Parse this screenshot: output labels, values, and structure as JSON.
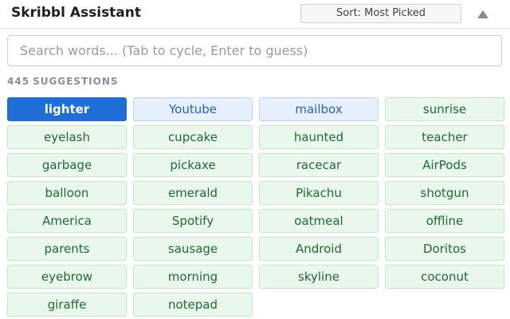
{
  "header": {
    "title": "Skribbl Assistant",
    "sort_label": "Sort: Most Picked",
    "collapse_icon": "triangle-up-icon"
  },
  "search": {
    "placeholder": "Search words... (Tab to cycle, Enter to guess)",
    "value": ""
  },
  "suggestions": {
    "count": "445",
    "count_label": "SUGGESTIONS",
    "selected_index": 0,
    "highlighted_indices": [
      1,
      2
    ],
    "words": [
      "lighter",
      "Youtube",
      "mailbox",
      "sunrise",
      "eyelash",
      "cupcake",
      "haunted",
      "teacher",
      "garbage",
      "pickaxe",
      "racecar",
      "AirPods",
      "balloon",
      "emerald",
      "Pikachu",
      "shotgun",
      "America",
      "Spotify",
      "oatmeal",
      "offline",
      "parents",
      "sausage",
      "Android",
      "Doritos",
      "eyebrow",
      "morning",
      "skyline",
      "coconut",
      "giraffe",
      "notepad"
    ]
  },
  "colors": {
    "selected": "#1f6ed8",
    "highlight_bg": "#e6f0fd",
    "chip_bg": "#e9f7ec",
    "chip_text": "#1f6a35"
  }
}
